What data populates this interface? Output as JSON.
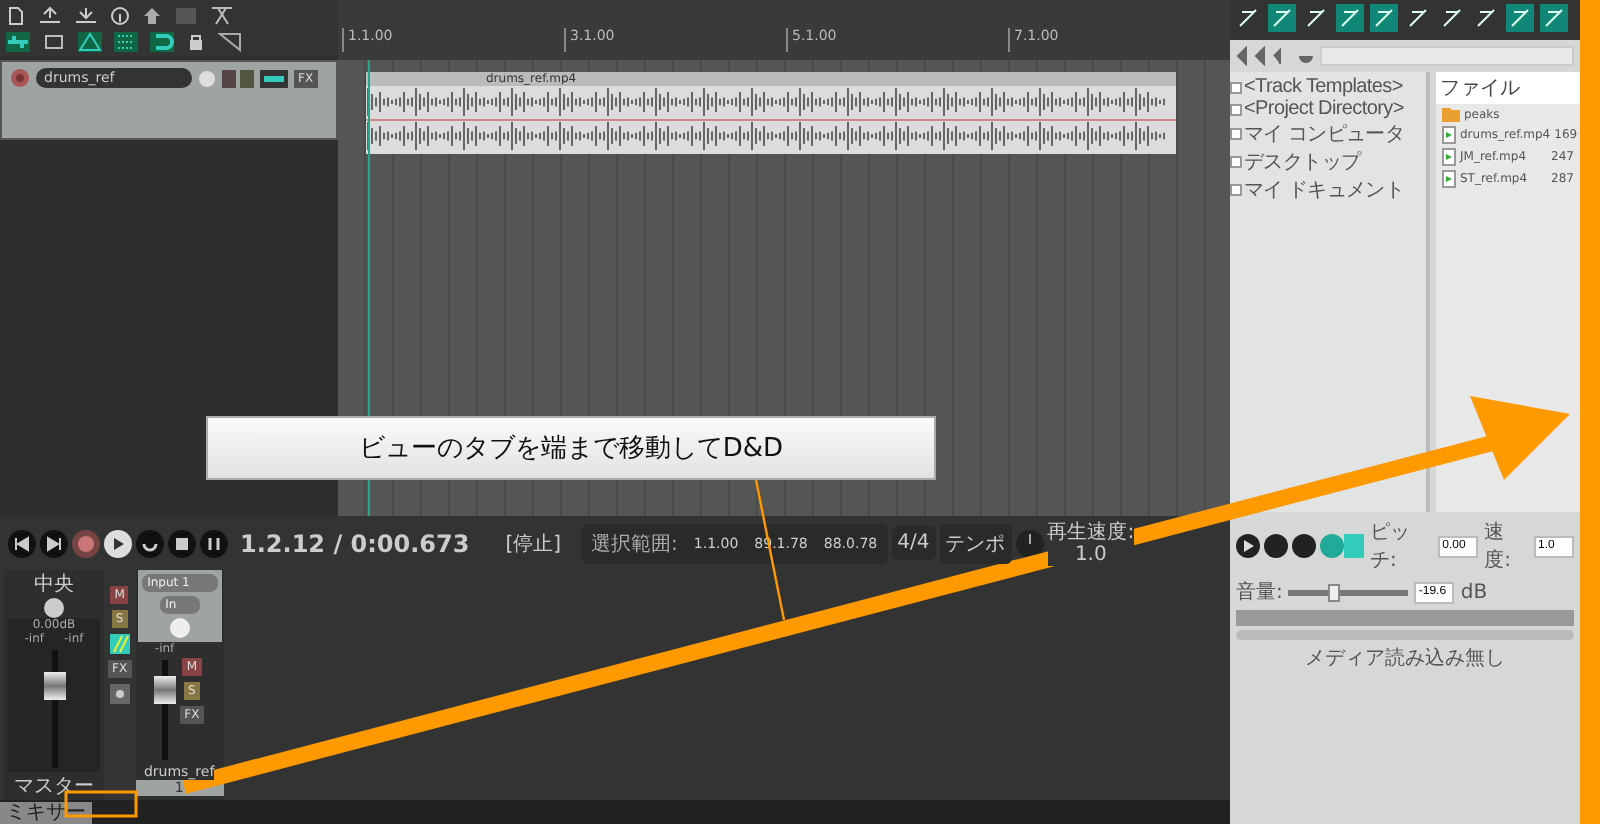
{
  "track": {
    "name": "drums_ref",
    "fx": "FX"
  },
  "ruler": [
    "1.1.00",
    "3.1.00",
    "5.1.00",
    "7.1.00"
  ],
  "item": {
    "name": "drums_ref.mp4"
  },
  "transport": {
    "time": "1.2.12 / 0:00.673",
    "state": "[停止]",
    "selection_label": "選択範囲:",
    "selection_start": "1.1.00",
    "selection_end": "89.1.78",
    "selection_length": "88.0.78",
    "time_signature": "4/4",
    "tempo_label": "テンポ",
    "rate_label": "再生速度:",
    "rate": "1.0"
  },
  "mixer": {
    "master": {
      "pan_label": "中央",
      "volume": "0.00dB",
      "peak_left": "-inf",
      "peak_right": "-inf",
      "mute": "M",
      "solo": "S",
      "fx": "FX",
      "name": "マスター",
      "fader": {
        "level": 0.72
      }
    },
    "track": {
      "input": "Input 1",
      "input_mode": "In",
      "peak": "-inf",
      "mute": "M",
      "solo": "S",
      "fx": "FX",
      "name": "drums_ref",
      "number": "1",
      "fader": {
        "level": 0.72
      }
    }
  },
  "status_tab": {
    "label": "ミキサー"
  },
  "media_explorer": {
    "tree": [
      {
        "label": "<Track Templates>"
      },
      {
        "label": "<Project Directory>"
      },
      {
        "label": "マイ コンピュータ"
      },
      {
        "label": "デスクトップ"
      },
      {
        "label": "マイ ドキュメント"
      }
    ],
    "column": "ファイル",
    "files": [
      {
        "kind": "folder",
        "name": "peaks"
      },
      {
        "kind": "media",
        "name": "drums_ref.mp4",
        "size": "169"
      },
      {
        "kind": "media",
        "name": "JM_ref.mp4",
        "size": "247"
      },
      {
        "kind": "media",
        "name": "ST_ref.mp4",
        "size": "287"
      }
    ],
    "pitch_label": "ピッチ:",
    "pitch": "0.00",
    "rate_label": "速度:",
    "rate": "1.0",
    "volume_label": "音量:",
    "volume": "-19.6",
    "volume_unit": "dB",
    "volume_slider": {
      "level": 0.38
    },
    "status": "メディア読み込み無し"
  },
  "callout": "ビューのタブを端まで移動してD&D"
}
